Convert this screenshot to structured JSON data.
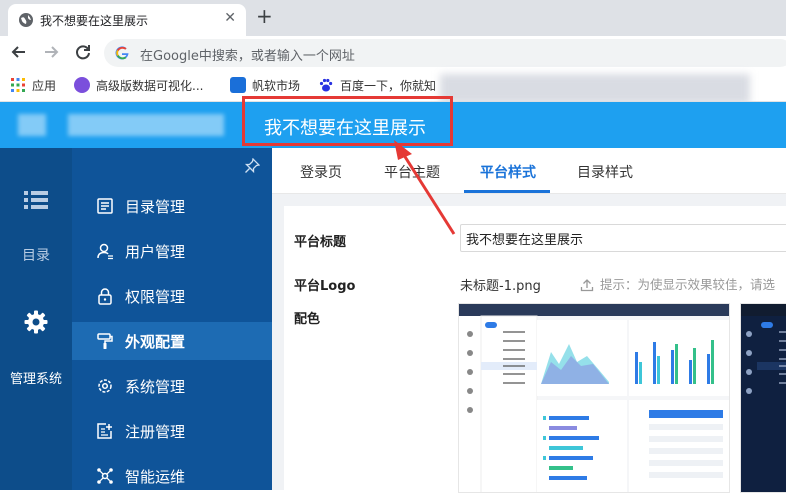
{
  "browser": {
    "tab_title": "我不想要在这里展示",
    "tab_close": "✕",
    "new_tab": "+",
    "omnibox_placeholder": "在Google中搜索，或者输入一个网址",
    "bookmarks": [
      {
        "label": "应用",
        "icon": "apps-grid-icon"
      },
      {
        "label": "高级版数据可视化...",
        "icon": "visualization-icon"
      },
      {
        "label": "帆软市场",
        "icon": "fanruan-icon"
      },
      {
        "label": "百度一下，你就知",
        "icon": "baidu-paw-icon"
      }
    ]
  },
  "header": {
    "platform_title": "我不想要在这里展示"
  },
  "rail": {
    "catalog_label": "目录",
    "system_label": "管理系统"
  },
  "menu": [
    {
      "label": "目录管理",
      "icon": "catalog-icon"
    },
    {
      "label": "用户管理",
      "icon": "user-icon"
    },
    {
      "label": "权限管理",
      "icon": "lock-icon"
    },
    {
      "label": "外观配置",
      "icon": "brush-icon",
      "active": true
    },
    {
      "label": "系统管理",
      "icon": "gear-icon"
    },
    {
      "label": "注册管理",
      "icon": "register-icon"
    },
    {
      "label": "智能运维",
      "icon": "ops-icon"
    }
  ],
  "tabs": [
    "登录页",
    "平台主题",
    "平台样式",
    "目录样式"
  ],
  "active_tab": "平台样式",
  "form": {
    "title_label": "平台标题",
    "title_value": "我不想要在这里展示",
    "logo_label": "平台Logo",
    "logo_file": "未标题-1.png",
    "hint": "提示：为使显示效果较佳，请选",
    "color_label": "配色"
  },
  "colors": {
    "header_blue": "#1ea0f0",
    "rail_dark": "#0d4d8a",
    "submenu_blue": "#0f5499",
    "accent": "#1a73d9",
    "annotation_red": "#e53935"
  }
}
